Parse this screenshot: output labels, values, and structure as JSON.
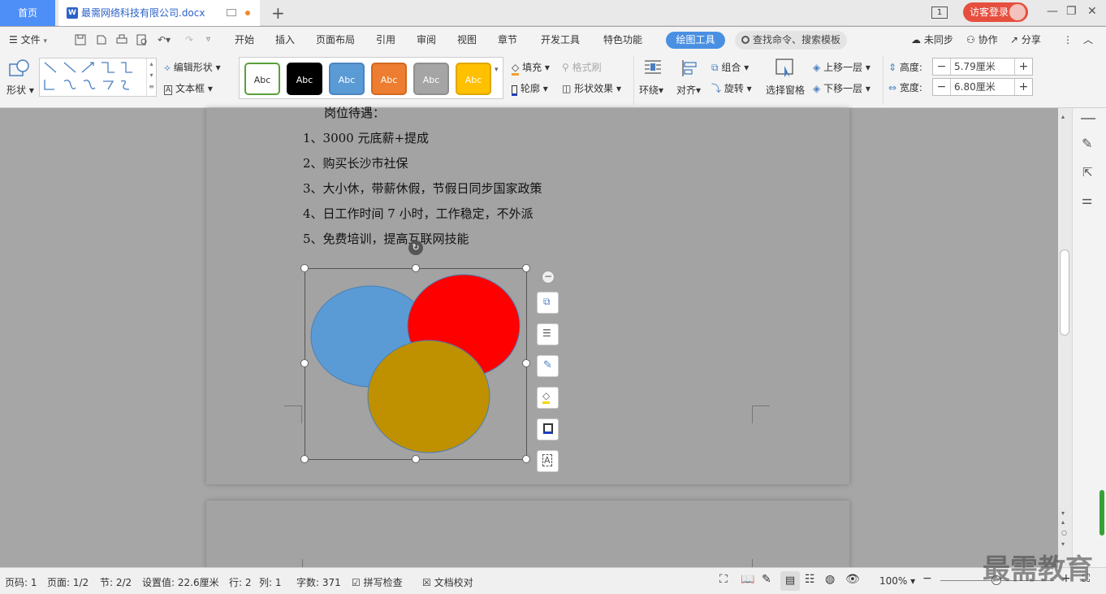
{
  "tabs": {
    "home": "首页",
    "document": "最需网络科技有限公司.docx",
    "login": "访客登录",
    "page_indicator": "1"
  },
  "menu": {
    "file": "文件",
    "items": [
      "开始",
      "插入",
      "页面布局",
      "引用",
      "审阅",
      "视图",
      "章节",
      "开发工具",
      "特色功能"
    ],
    "active": "绘图工具",
    "search": "查找命令、搜索模板",
    "sync": "未同步",
    "collab": "协作",
    "share": "分享"
  },
  "ribbon": {
    "shape": "形状",
    "edit_shape": "编辑形状",
    "textbox": "文本框",
    "styles": [
      {
        "label": "Abc",
        "bg": "#ffffff",
        "fg": "#333333",
        "border": "#5aa03c"
      },
      {
        "label": "Abc",
        "bg": "#000000",
        "fg": "#ffffff",
        "border": "#000000"
      },
      {
        "label": "Abc",
        "bg": "#5b9bd5",
        "fg": "#ffffff",
        "border": "#4a86be"
      },
      {
        "label": "Abc",
        "bg": "#ed7d31",
        "fg": "#ffffff",
        "border": "#d06a22"
      },
      {
        "label": "Abc",
        "bg": "#a5a5a5",
        "fg": "#ffffff",
        "border": "#8f8f8f"
      },
      {
        "label": "Abc",
        "bg": "#ffc000",
        "fg": "#ffffff",
        "border": "#e0a800"
      }
    ],
    "fill": "填充",
    "format_brush": "格式刷",
    "outline": "轮廓",
    "shape_effect": "形状效果",
    "wrap": "环绕",
    "align": "对齐",
    "group": "组合",
    "rotate": "旋转",
    "selection_pane": "选择窗格",
    "bring_forward": "上移一层",
    "send_backward": "下移一层",
    "height_label": "高度:",
    "height_value": "5.79厘米",
    "width_label": "宽度:",
    "width_value": "6.80厘米"
  },
  "document": {
    "heading": "岗位待遇：",
    "lines": [
      "1、3000 元底薪+提成",
      "2、购买长沙市社保",
      "3、大小休，带薪休假，节假日同步国家政策",
      "4、日工作时间 7 小时，工作稳定，不外派",
      "5、免费培训，提高互联网技能"
    ],
    "circles": [
      {
        "name": "blue",
        "color": "#5b9bd5"
      },
      {
        "name": "red",
        "color": "#ff0000"
      },
      {
        "name": "gold",
        "color": "#bf9000"
      }
    ]
  },
  "status": {
    "page_code": "页码: 1",
    "page": "页面: 1/2",
    "section": "节: 2/2",
    "setting": "设置值: 22.6厘米",
    "row": "行: 2",
    "col": "列: 1",
    "words": "字数: 371",
    "spell": "拼写检查",
    "proof": "文档校对",
    "zoom": "100%"
  },
  "watermark": "最需教育"
}
